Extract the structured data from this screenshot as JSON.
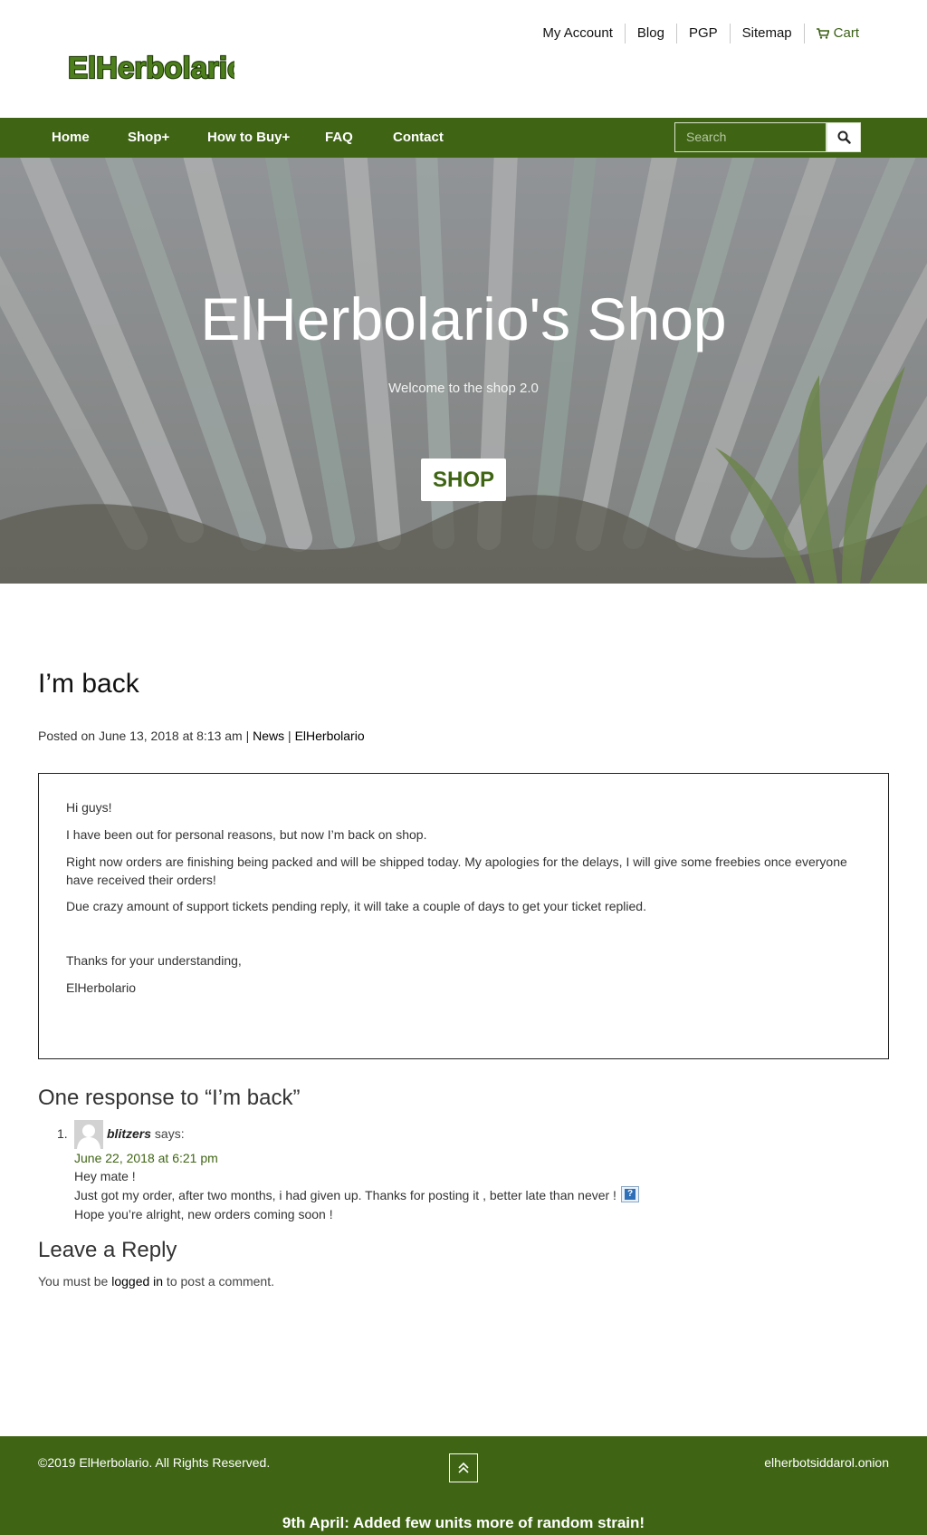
{
  "site": {
    "logo_text": "ElHerbolario"
  },
  "top_links": {
    "my_account": "My Account",
    "blog": "Blog",
    "pgp": "PGP",
    "sitemap": "Sitemap",
    "cart": "Cart",
    "cart_icon": "cart-icon"
  },
  "nav": {
    "items": [
      "Home",
      "Shop+",
      "How to Buy+",
      "FAQ",
      "Contact"
    ],
    "search_placeholder": "Search",
    "search_icon": "search-icon"
  },
  "hero": {
    "title": "ElHerbolario's Shop",
    "subtitle": "Welcome to the shop 2.0",
    "button": "SHOP"
  },
  "post": {
    "title": "I’m back",
    "meta_prefix": "Posted on June 13, 2018 at 8:13 am | ",
    "category": "News",
    "separator": " | ",
    "author": "ElHerbolario",
    "paragraphs": [
      "Hi guys!",
      "I have been out for personal reasons, but now I’m back on shop.",
      "Right now orders are finishing being packed and will be shipped today. My apologies for the delays, I will give some freebies once everyone have received their orders!",
      "Due crazy amount of support tickets pending reply, it will take a couple of days to get your ticket replied.",
      "Thanks for your understanding,",
      "ElHerbolario"
    ]
  },
  "comments": {
    "title": "One response to “I’m back”",
    "items": [
      {
        "number": "1.",
        "author": "blitzers",
        "says": "says:",
        "date": "June 22, 2018 at 6:21 pm",
        "lines": [
          "Hey mate !",
          "Just got my order, after two months, i had given up. Thanks for posting it , better late than never !",
          "Hope you’re alright, new orders coming soon !"
        ],
        "smiley": "?"
      }
    ]
  },
  "reply": {
    "title": "Leave a Reply",
    "prefix": "You must be ",
    "link": "logged in",
    "suffix": " to post a comment."
  },
  "footer": {
    "copyright": "©2019 ElHerbolario. All Rights Reserved.",
    "onion": "elherbotsiddarol.onion",
    "news": "9th April: Added few units more of random strain!",
    "top_icon": "scroll-to-top-icon"
  },
  "colors": {
    "brand_green": "#3f6514",
    "link_green": "#3b6015"
  }
}
